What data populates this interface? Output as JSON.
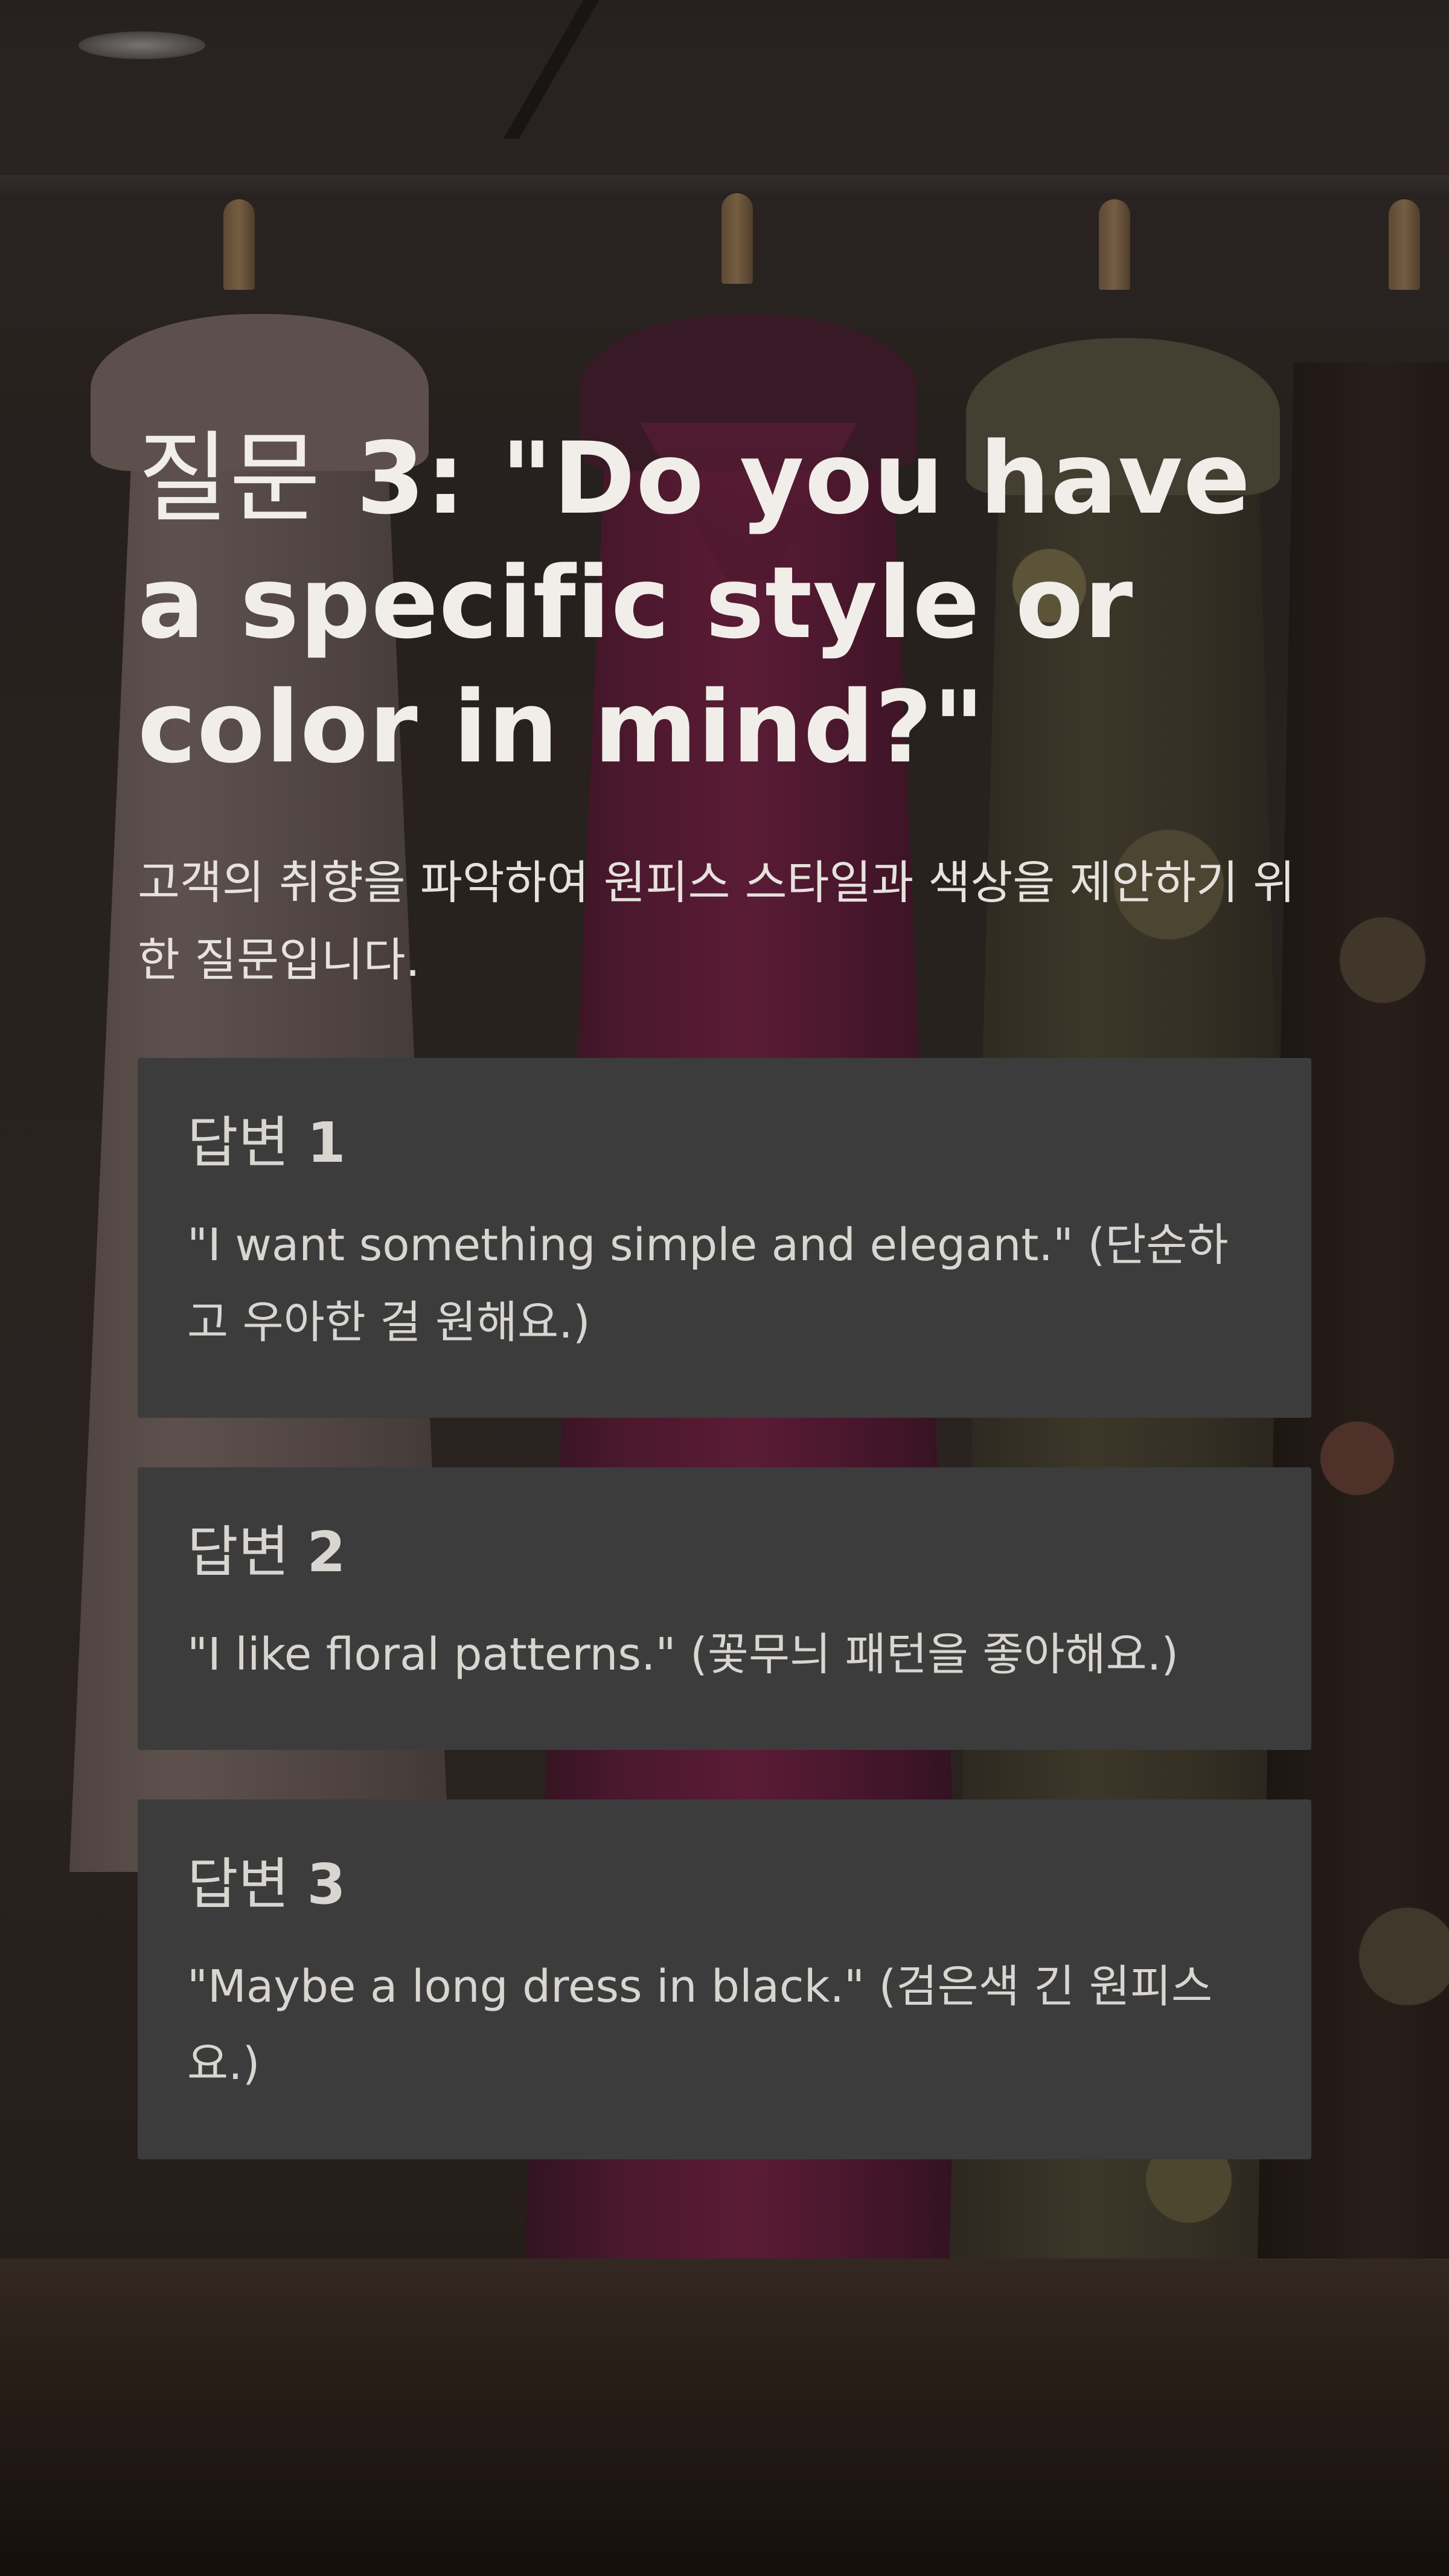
{
  "slide": {
    "question": {
      "label": "질문",
      "text": "3: \"Do you have a specific style or color in mind?\""
    },
    "description": "고객의 취향을 파악하여 원피스 스타일과 색상을 제안하기 위한 질문입니다.",
    "answers": [
      {
        "label": "답변",
        "number": "1",
        "text": "\"I want something simple and elegant.\" (단순하고 우아한 걸 원해요.)"
      },
      {
        "label": "답변",
        "number": "2",
        "text": "\"I like floral patterns.\" (꽃무늬 패턴을 좋아해요.)"
      },
      {
        "label": "답변",
        "number": "3",
        "text": "\"Maybe a long dress in black.\" (검은색 긴 원피스요.)"
      }
    ]
  },
  "colors": {
    "card_background": "#3c3c3c",
    "title_text": "#f1eee9",
    "body_text": "#d9d6d1"
  }
}
